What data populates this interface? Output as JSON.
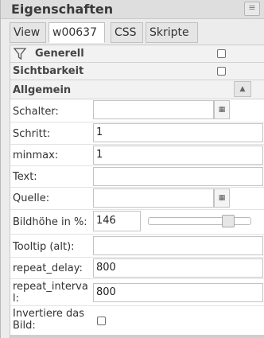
{
  "window": {
    "title": "Eigenschaften",
    "menu_icon": "grip-lines-icon"
  },
  "tabs": [
    {
      "label": "View",
      "active": false
    },
    {
      "label": "w00637",
      "active": true
    },
    {
      "label": "CSS",
      "active": false
    },
    {
      "label": "Skripte",
      "active": false
    }
  ],
  "sections": {
    "general": {
      "label": "Generell",
      "icon": "filter-icon",
      "checked": false
    },
    "visibility": {
      "label": "Sichtbarkeit",
      "checked": false
    },
    "common": {
      "label": "Allgemein",
      "collapse_icon": "triangle-up-icon"
    }
  },
  "fields": {
    "schalter": {
      "label": "Schalter:",
      "value": ""
    },
    "schritt": {
      "label": "Schritt:",
      "value": "1"
    },
    "minmax": {
      "label": "minmax:",
      "value": "1"
    },
    "text": {
      "label": "Text:",
      "value": ""
    },
    "quelle": {
      "label": "Quelle:",
      "value": ""
    },
    "bildhoehe": {
      "label": "Bildhöhe in %:",
      "value": "146",
      "slider_level_fraction": 0.82
    },
    "tooltip": {
      "label": "Tooltip (alt):",
      "value": ""
    },
    "repeat_delay": {
      "label": "repeat_delay:",
      "value": "800"
    },
    "repeat_interval": {
      "label_line1": "repeat_interva",
      "label_line2": "l:",
      "value": "800"
    },
    "invert": {
      "label_line1": "Invertiere das",
      "label_line2": "Bild:",
      "checked": false
    }
  },
  "picker_icon": "list-picker-icon"
}
